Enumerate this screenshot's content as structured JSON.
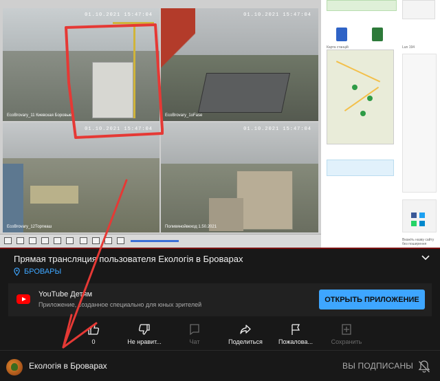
{
  "video": {
    "cameras": [
      {
        "timestamp": "01.10.2021 15:47:04",
        "label": "EcoBrovary_11 Киевская Боровые"
      },
      {
        "timestamp": "01.10.2021 15:47:04",
        "label": "EcoBrovary_1oFase"
      },
      {
        "timestamp": "01.10.2021 15:47:04",
        "label": "EcoBrovary_12Торгмаш"
      },
      {
        "timestamp": "01.10.2021 15:47:04",
        "label": "Поливянойвеход 1.50.2021"
      }
    ],
    "sidebar": {
      "map_label": "Карта станцій",
      "station_label": "Lun 194",
      "info_text": "Вкажіть назву сайту без поширення"
    }
  },
  "video_info": {
    "title": "Прямая трансляция пользователя Екологія в Броварах",
    "location": "БРОВАРЫ"
  },
  "promo": {
    "title": "YouTube Детям",
    "subtitle": "Приложение, созданное специально для юных зрителей",
    "button": "ОТКРЫТЬ ПРИЛОЖЕНИЕ"
  },
  "actions": [
    {
      "label": "0",
      "icon": "thumbs-up-icon"
    },
    {
      "label": "Не нравит...",
      "icon": "thumbs-down-icon"
    },
    {
      "label": "Чат",
      "icon": "chat-icon"
    },
    {
      "label": "Поделиться",
      "icon": "share-icon"
    },
    {
      "label": "Пожалова...",
      "icon": "flag-icon"
    },
    {
      "label": "Сохранить",
      "icon": "add-to-playlist-icon"
    }
  ],
  "channel": {
    "name": "Екологія в Броварах",
    "subscribed_label": "ВЫ ПОДПИСАНЫ"
  },
  "colors": {
    "background": "#181818",
    "accent": "#3ea6ff",
    "annotation": "#e53935"
  }
}
